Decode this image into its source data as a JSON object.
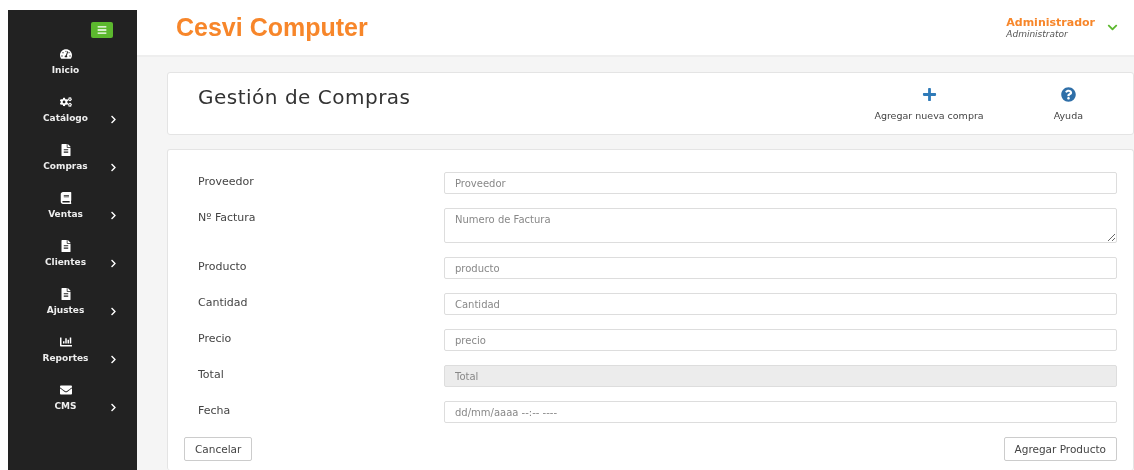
{
  "app": {
    "title": "Cesvi Computer"
  },
  "user": {
    "name": "Administrador",
    "role": "Administrator"
  },
  "sidebar": {
    "items": [
      {
        "label": "Inicio",
        "expandable": false
      },
      {
        "label": "Catálogo",
        "expandable": true
      },
      {
        "label": "Compras",
        "expandable": true
      },
      {
        "label": "Ventas",
        "expandable": true
      },
      {
        "label": "Clientes",
        "expandable": true
      },
      {
        "label": "Ajustes",
        "expandable": true
      },
      {
        "label": "Reportes",
        "expandable": true
      },
      {
        "label": "CMS",
        "expandable": true
      }
    ]
  },
  "page_header": {
    "title": "Gestión de Compras",
    "actions": [
      {
        "label": "Agregar nueva compra",
        "kind": "add"
      },
      {
        "label": "Ayuda",
        "kind": "help"
      }
    ]
  },
  "form": {
    "fields": [
      {
        "label": "Proveedor",
        "placeholder": "Proveedor",
        "kind": "input",
        "disabled": false
      },
      {
        "label": "Nº Factura",
        "placeholder": "Numero de Factura",
        "kind": "textarea",
        "disabled": false
      },
      {
        "label": "Producto",
        "placeholder": "producto",
        "kind": "input",
        "disabled": false
      },
      {
        "label": "Cantidad",
        "placeholder": "Cantidad",
        "kind": "input",
        "disabled": false
      },
      {
        "label": "Precio",
        "placeholder": "precio",
        "kind": "input",
        "disabled": false
      },
      {
        "label": "Total",
        "placeholder": "Total",
        "kind": "input",
        "disabled": true
      },
      {
        "label": "Fecha",
        "placeholder": "dd/mm/aaaa --:-- ----",
        "kind": "date",
        "disabled": false
      }
    ],
    "buttons": [
      "Cancelar",
      "Agregar Producto"
    ]
  }
}
